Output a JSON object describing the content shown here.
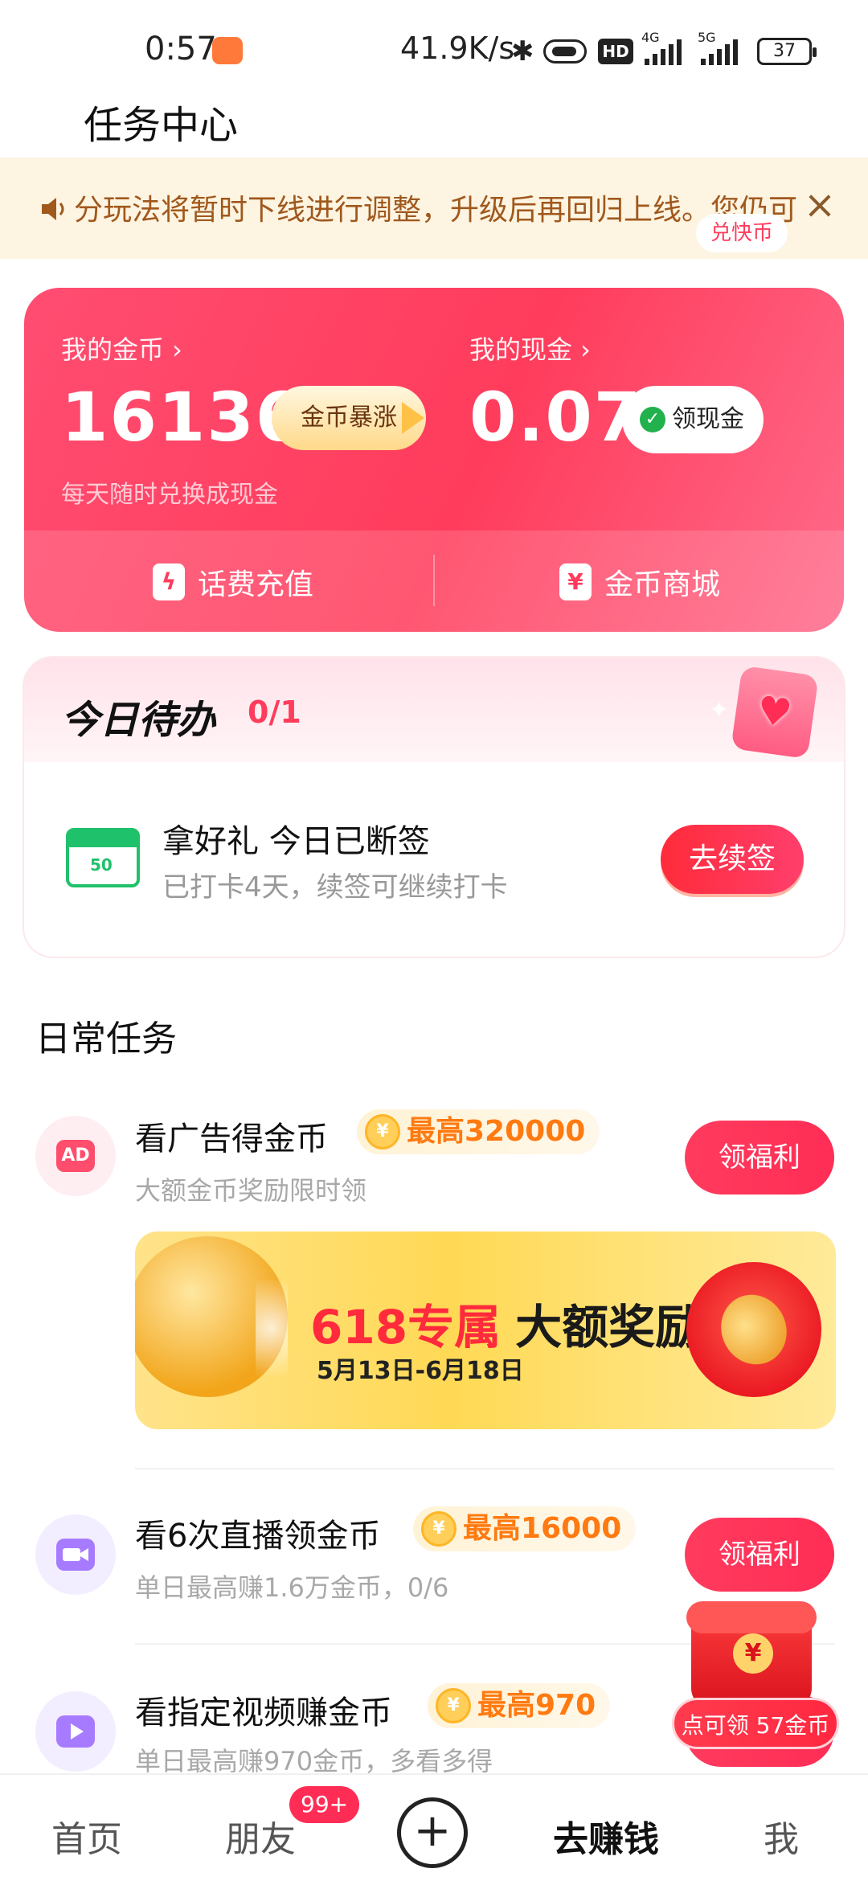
{
  "status_bar": {
    "time": "0:57",
    "net_speed": "41.9K/s",
    "hd_label": "HD",
    "signal_1_label": "4G",
    "signal_2_label": "5G",
    "battery": "37"
  },
  "page": {
    "title": "任务中心"
  },
  "notice": {
    "text": "分玩法将暂时下线进行调整，升级后再回归上线。您仍可"
  },
  "coins_card": {
    "coins_label": "我的金币 ›",
    "coins_value": "16136",
    "surge_label": "金币暴涨",
    "cash_label": "我的现金 ›",
    "cash_value": "0.07",
    "withdraw_label": "领现金",
    "hint": "每天随时兑换成现金",
    "phone_recharge_label": "话费充值",
    "coin_mall_label": "金币商城",
    "coin_mall_badge": "兑快币"
  },
  "todo": {
    "title": "今日待办",
    "count": "0/1",
    "gift_icon_text": "50",
    "item_title": "拿好礼 今日已断签",
    "item_sub": "已打卡4天，续签可继续打卡",
    "button_label": "去续签"
  },
  "daily": {
    "title": "日常任务",
    "tasks": [
      {
        "icon": "AD",
        "name": "看广告得金币",
        "reward": "最高320000",
        "sub": "大额金币奖励限时领",
        "button": "领福利"
      },
      {
        "icon": "video-camera",
        "name": "看6次直播领金币",
        "reward": "最高16000",
        "sub": "单日最高赚1.6万金币，0/6",
        "button": "领福利"
      },
      {
        "icon": "play",
        "name": "看指定视频赚金币",
        "reward": "最高970",
        "sub": "单日最高赚970金币，多看多得",
        "button": ""
      }
    ],
    "promo": {
      "accent": "618专属",
      "main": "大额奖励",
      "dates": "5月13日-6月18日"
    }
  },
  "floating": {
    "label": "点可领 57金币"
  },
  "nav": {
    "home": "首页",
    "friends": "朋友",
    "friends_badge": "99+",
    "plus": "+",
    "earn": "去赚钱",
    "me": "我"
  },
  "colors": {
    "primary": "#ff3c5c",
    "notice_bg": "#fdf4e1",
    "notice_text": "#a0581c",
    "reward_text": "#ff7a10"
  }
}
